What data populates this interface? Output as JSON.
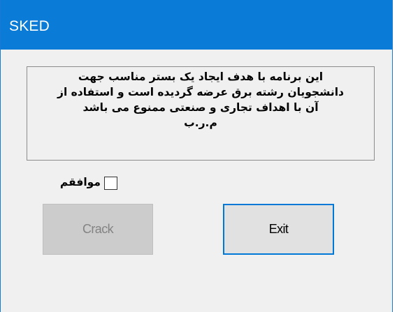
{
  "window": {
    "title": "SKED",
    "accent_color": "#0a7bd7"
  },
  "message": {
    "lines": [
      "این برنامه با هدف ایجاد یک بستر مناسب جهت",
      "دانشجویان رشته برق عرضه گردیده است و استفاده از",
      "آن با اهداف تجاری و صنعتی ممنوع می باشد",
      "م.ر.ب"
    ]
  },
  "agree": {
    "label": "موافقم",
    "checked": false
  },
  "buttons": {
    "crack_label": "Crack",
    "crack_enabled": false,
    "exit_label": "Exit"
  }
}
